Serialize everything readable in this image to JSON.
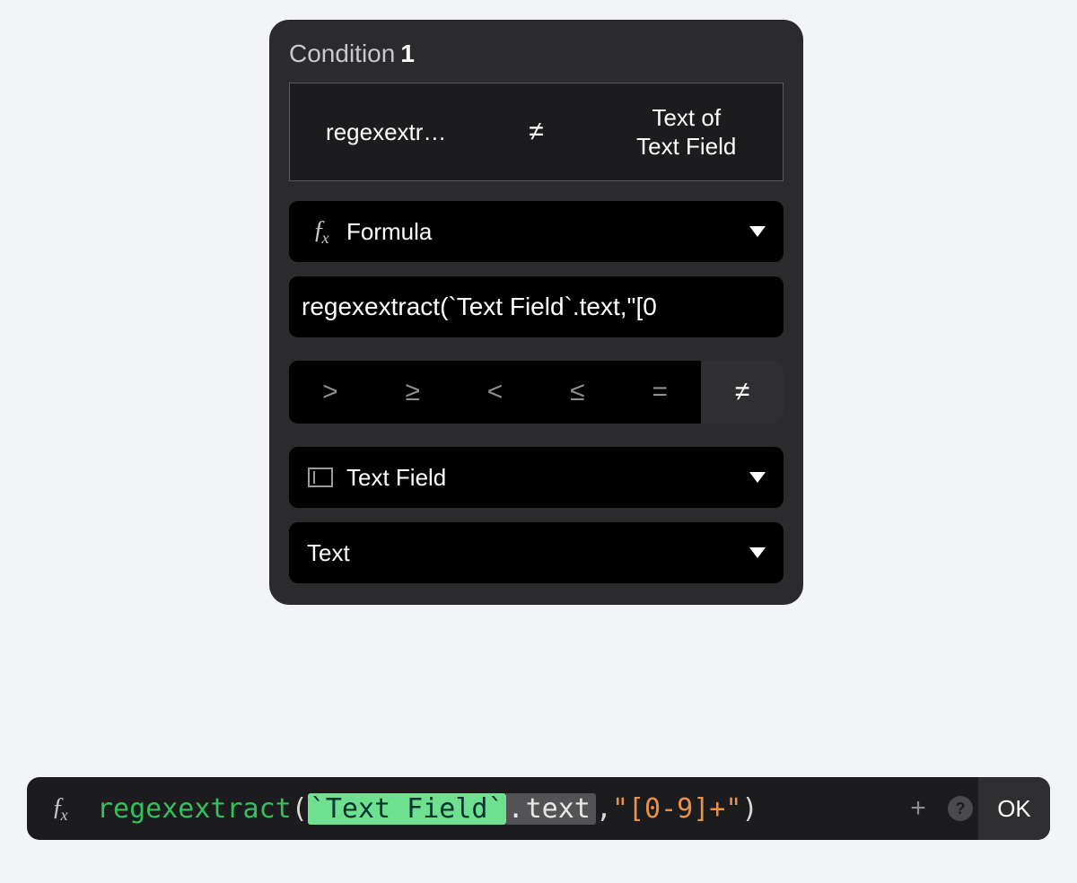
{
  "panel": {
    "title_label": "Condition",
    "title_number": "1",
    "summary": {
      "left": "regexextr…",
      "operator": "≠",
      "right_line1": "Text of",
      "right_line2": "Text Field"
    },
    "type_selector": {
      "label": "Formula"
    },
    "formula_preview": "regexextract(`Text Field`.text,\"[0",
    "operators": [
      {
        "glyph": ">",
        "selected": false
      },
      {
        "glyph": "≥",
        "selected": false
      },
      {
        "glyph": "<",
        "selected": false
      },
      {
        "glyph": "≤",
        "selected": false
      },
      {
        "glyph": "=",
        "selected": false
      },
      {
        "glyph": "≠",
        "selected": true
      }
    ],
    "target_selector": {
      "label": "Text Field"
    },
    "property_selector": {
      "label": "Text"
    }
  },
  "formula_bar": {
    "tokens": {
      "func": "regexextract",
      "open": "(",
      "ref": "`Text Field`",
      "dot": ".",
      "prop": "text",
      "comma": ",",
      "str": "\"[0-9]+\"",
      "close": ")"
    },
    "ok_label": "OK",
    "help_glyph": "?",
    "plus_glyph": "+"
  }
}
